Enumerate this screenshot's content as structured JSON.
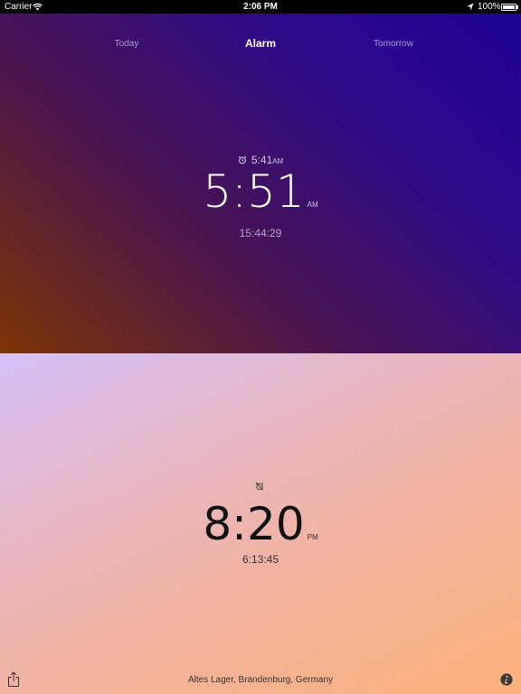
{
  "status_bar": {
    "carrier": "Carrier",
    "time": "2:06 PM",
    "battery": "100%"
  },
  "tabs": [
    {
      "label": "Today",
      "active": false
    },
    {
      "label": "Alarm",
      "active": true
    },
    {
      "label": "Tomorrow",
      "active": false
    }
  ],
  "top": {
    "alarm_time": "5:41",
    "alarm_ampm": "AM",
    "time": "5:51",
    "ampm": "AM",
    "countdown": "15:44:29"
  },
  "bottom": {
    "time": "8:20",
    "ampm": "PM",
    "countdown": "6:13:45",
    "location": "Altes Lager, Brandenburg, Germany"
  },
  "colors": {
    "top_gradient_start": "#200294",
    "top_gradient_end": "#7f3405",
    "bottom_gradient_start": "#d4c0f8",
    "bottom_gradient_end": "#fdb17b"
  },
  "icons": {
    "wifi": "wifi-icon",
    "location": "location-arrow-icon",
    "battery": "battery-icon",
    "alarm": "alarm-clock-icon",
    "no_alarm": "alarm-off-icon",
    "share": "share-icon",
    "info": "info-icon"
  }
}
